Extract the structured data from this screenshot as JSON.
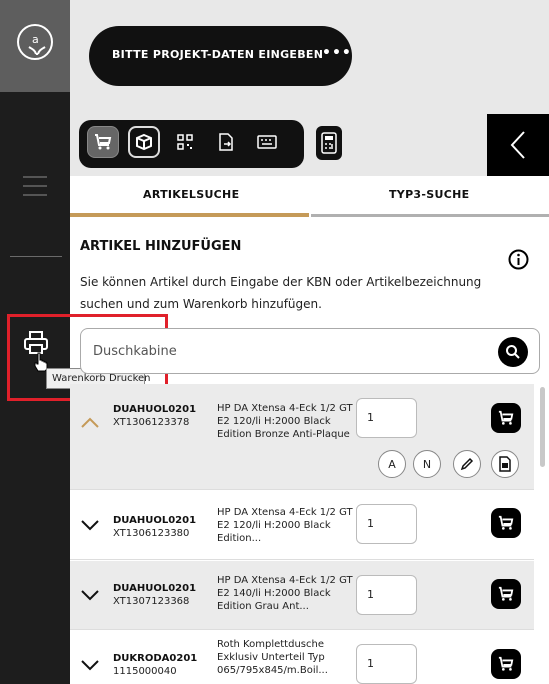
{
  "header": {
    "project_label": "BITTE PROJEKT-DATEN EINGEBEN",
    "more_label": "•••"
  },
  "tooltip": {
    "text": "Warenkorb Drucken"
  },
  "tabs": [
    {
      "label": "ARTIKELSUCHE"
    },
    {
      "label": "TYP3-SUCHE"
    }
  ],
  "section": {
    "title": "ARTIKEL HINZUFÜGEN",
    "description": "Sie können Artikel durch Eingabe der KBN oder Artikelbezeichnung suchen und zum Warenkorb hinzufügen."
  },
  "search": {
    "value": "Duschkabine"
  },
  "items": [
    {
      "kbn": "DUAHUOL0201",
      "number": "XT1306123378",
      "description": "HP DA Xtensa 4-Eck 1/2 GT E2 120/li H:2000 Black Edition Bronze Anti-Plaque",
      "qty": "1"
    },
    {
      "kbn": "DUAHUOL0201",
      "number": "XT1306123380",
      "description": "HP DA Xtensa 4-Eck 1/2 GT E2 120/li H:2000 Black Edition...",
      "qty": "1"
    },
    {
      "kbn": "DUAHUOL0201",
      "number": "XT1307123368",
      "description": "HP DA Xtensa 4-Eck 1/2 GT E2 140/li H:2000 Black Edition Grau Ant...",
      "qty": "1"
    },
    {
      "kbn": "DUKRODA0201",
      "number": "1115000040",
      "description": "Roth Komplettdusche Exklusiv Unterteil Typ 065/795x845/m.Boil...",
      "qty": "1"
    }
  ],
  "item_actions": {
    "a_label": "A",
    "n_label": "N"
  },
  "colors": {
    "accent": "#c59a58",
    "highlight": "#e0202a",
    "rail": "#1d1d1d"
  }
}
